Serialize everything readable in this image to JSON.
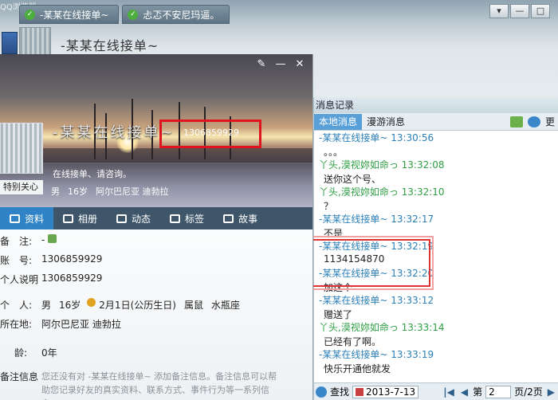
{
  "browser_label": "QQ浏览器",
  "top_tabs": [
    {
      "label": "-某某在线接单~"
    },
    {
      "label": "忐忑不安尼玛逼。"
    }
  ],
  "chat": {
    "title": "-某某在线接单~",
    "window_controls": [
      "▾",
      "—",
      "□"
    ]
  },
  "history": {
    "title": "消息记录",
    "tabs": [
      "本地消息",
      "漫游消息"
    ],
    "more_label": "更",
    "messages": [
      {
        "type": "hdr",
        "who": "me",
        "text": "-某某在线接单~ 13:30:56"
      },
      {
        "type": "body",
        "text": "。。。"
      },
      {
        "type": "hdr",
        "who": "peer",
        "text": "丫头,漠视妳如命っ 13:32:08"
      },
      {
        "type": "body",
        "text": "送你这个号、"
      },
      {
        "type": "hdr",
        "who": "peer",
        "text": "丫头,漠视妳如命っ 13:32:10"
      },
      {
        "type": "body",
        "text": "？"
      },
      {
        "type": "hdr",
        "who": "me",
        "text": "-某某在线接单~ 13:32:17"
      },
      {
        "type": "body",
        "text": "不是"
      },
      {
        "type": "hdr",
        "who": "me",
        "text": "-某某在线接单~ 13:32:19"
      },
      {
        "type": "body",
        "text": "1134154870"
      },
      {
        "type": "hdr",
        "who": "me",
        "text": "-某某在线接单~ 13:32:20"
      },
      {
        "type": "body",
        "text": "加这个"
      },
      {
        "type": "hdr",
        "who": "me",
        "text": "-某某在线接单~ 13:33:12"
      },
      {
        "type": "body",
        "text": "赠送了"
      },
      {
        "type": "hdr",
        "who": "peer",
        "text": "丫头,漠视妳如命っ 13:33:14"
      },
      {
        "type": "body",
        "text": "已经有了啊。"
      },
      {
        "type": "hdr",
        "who": "me",
        "text": "-某某在线接单~ 13:33:19"
      },
      {
        "type": "body",
        "text": "快乐开通他就发"
      }
    ],
    "footer": {
      "search_label": "查找",
      "date": "2013-7-13",
      "page_prefix": "第",
      "page_value": "2",
      "page_suffix": "页/2页"
    }
  },
  "profile": {
    "name": "-某某在线接单~",
    "qq_number": "1306859929",
    "signature": "在线接单、请咨询。",
    "special_care": "特别关心",
    "basic": [
      "男",
      "16岁",
      "阿尔巴尼亚 迪勃拉"
    ],
    "controls": [
      "✎",
      "—",
      "✕"
    ],
    "nav": [
      {
        "label": "资料",
        "active": true
      },
      {
        "label": "相册",
        "active": false
      },
      {
        "label": "动态",
        "active": false
      },
      {
        "label": "标签",
        "active": false
      },
      {
        "label": "故事",
        "active": false
      }
    ],
    "fields": {
      "remark_label": "备　注:",
      "remark_value": "-",
      "account_label": "账　号:",
      "account_value": "1306859929",
      "desc_label": "个人说明",
      "desc_value": "1306859929",
      "personal_label": "个　人:",
      "gender": "男",
      "age": "16岁",
      "birthday": "2月1日(公历生日)",
      "zodiac": "属鼠",
      "star_sign": "水瓶座",
      "location_label": "所在地:",
      "location_value": "阿尔巴尼亚 迪勃拉",
      "qage_label": "龄:",
      "qage_value": "0年",
      "remark_info_label": "备注信息",
      "remark_info_text": "您还没有对 -某某在线接单~ 添加备注信息。备注信息可以帮助您记录好友的真实资料、联系方式、事件行为等一系列信息。"
    }
  }
}
